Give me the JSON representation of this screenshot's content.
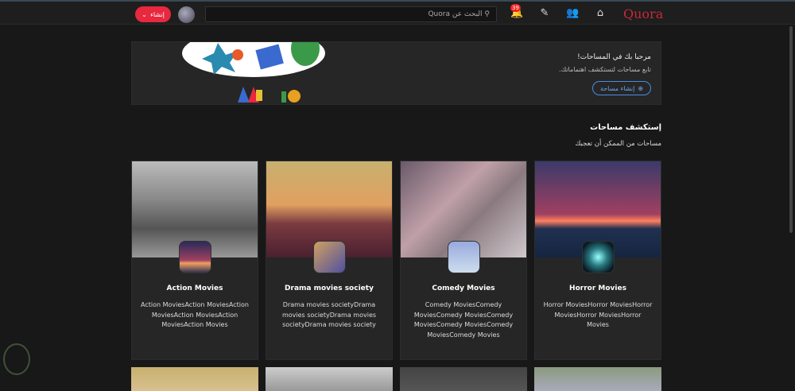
{
  "header": {
    "logo": "Quora",
    "search_placeholder": "البحث عن Quora",
    "notification_count": "39",
    "create_label": "إنشاء"
  },
  "banner": {
    "title": "مرحبا بك في المساحات!",
    "subtitle": "تابع مساحات لتستكشف اهتماماتك.",
    "button": "إنشاء مساحة"
  },
  "section": {
    "title": "إستكشف مساحات",
    "subtitle": "مساحات من الممكن أن تعجبك"
  },
  "cards": [
    {
      "title": "Horror Movies",
      "desc": "Horror MoviesHorror MoviesHorror MoviesHorror MoviesHorror Movies",
      "img": "linear-gradient(#3a3a6a,#a04060 55%,#ff8060 62%,#203050 70%,#152540)",
      "icon": "radial-gradient(circle,#9ff 0%,#2a7a80 40%,#0a1a25 80%)"
    },
    {
      "title": "Comedy Movies",
      "desc": "Comedy MoviesComedy MoviesComedy MoviesComedy MoviesComedy MoviesComedy MoviesComedy Movies",
      "img": "linear-gradient(135deg,#6a5a6a,#c0a0a8 40%,#8a7a80 60%,#d0c8cc)",
      "icon": "linear-gradient(#9ad,#cde)"
    },
    {
      "title": "Drama movies society",
      "desc": "Drama movies societyDrama movies societyDrama movies societyDrama movies society",
      "img": "linear-gradient(#c8b070,#e0a060 45%,#7a3a40 65%,#4a2030)",
      "icon": "linear-gradient(135deg,#d0a060,#5050a0)"
    },
    {
      "title": "Action Movies",
      "desc": "Action MoviesAction MoviesAction MoviesAction MoviesAction MoviesAction Movies",
      "img": "linear-gradient(#bbb,#888 40%,#555 70%,#999)",
      "icon": "linear-gradient(#2a2a5a,#a04060 60%,#f0a060 70%,#303050)"
    }
  ],
  "row2": [
    "linear-gradient(#8a9a80,#aab)",
    "linear-gradient(#444,#555)",
    "linear-gradient(#ccc,#999)",
    "linear-gradient(#c8b070,#d8c090)"
  ]
}
